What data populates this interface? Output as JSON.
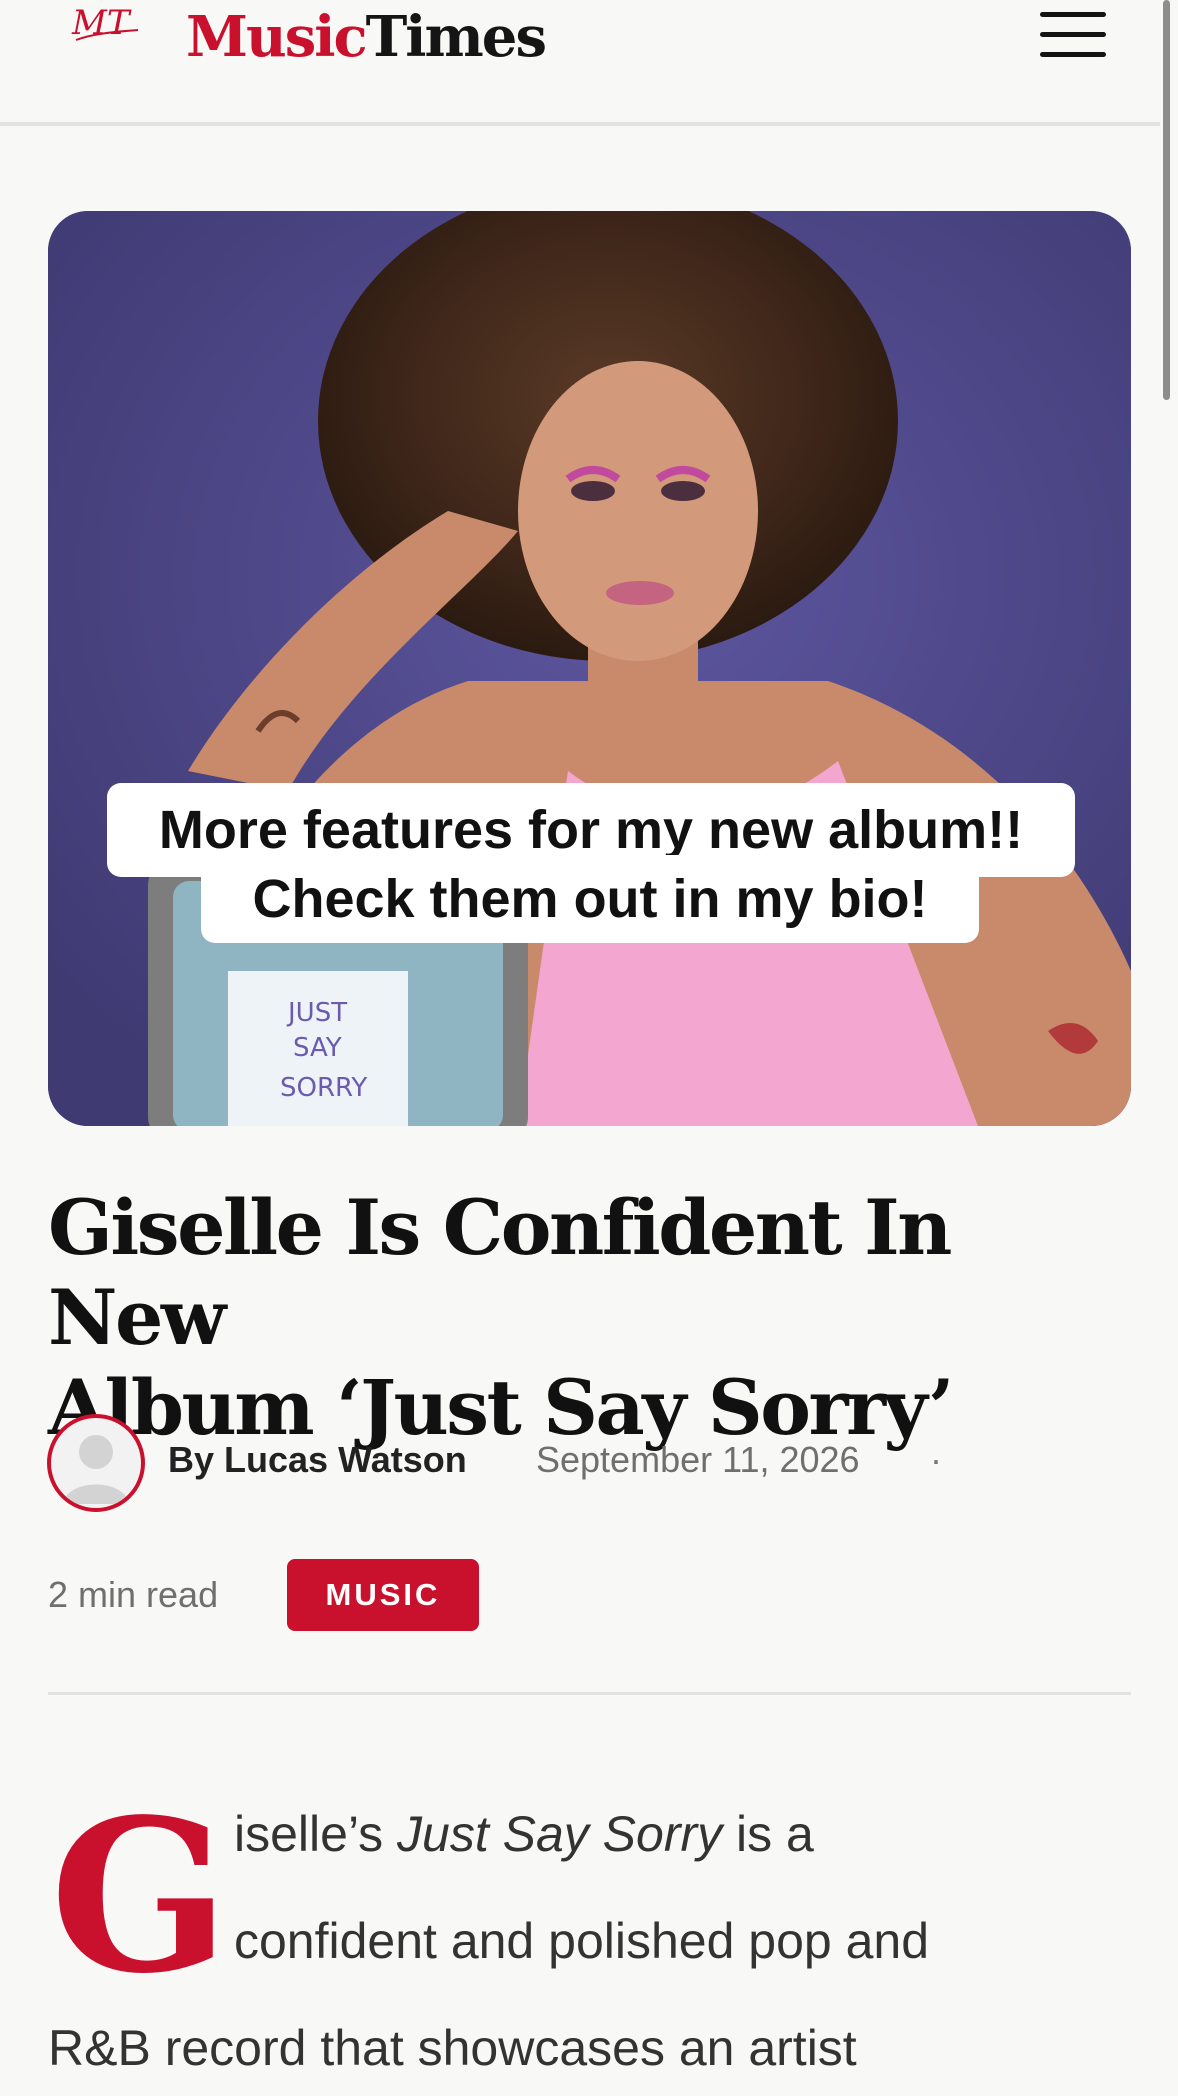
{
  "header": {
    "logo_mark": "MT",
    "brand_music": "Music",
    "brand_times": "Times"
  },
  "hero": {
    "caption_line1": "More features for my new album!!",
    "caption_line2": "Check them out in my bio!",
    "sign_words": [
      "JUST",
      "SAY",
      "SORRY"
    ]
  },
  "article": {
    "title_line1": "Giselle Is Confident In New",
    "title_line2": "Album ‘Just Say Sorry’",
    "author": "By Lucas Watson",
    "date": "September 11, 2026",
    "separator": "·",
    "read_time": "2 min read",
    "category": "MUSIC",
    "dropcap": "G",
    "body_line1_prefix": "iselle’s ",
    "body_line1_italic": "Just Say Sorry",
    "body_line1_suffix": " is a",
    "body_line2": "confident and polished pop and",
    "body_line3": "R&B record that showcases an artist"
  },
  "colors": {
    "accent": "#c9102d",
    "background": "#f8f8f7",
    "hero_backdrop": "#4a4482"
  },
  "icons": {
    "menu": "hamburger-menu-icon",
    "avatar": "default-user-avatar"
  }
}
